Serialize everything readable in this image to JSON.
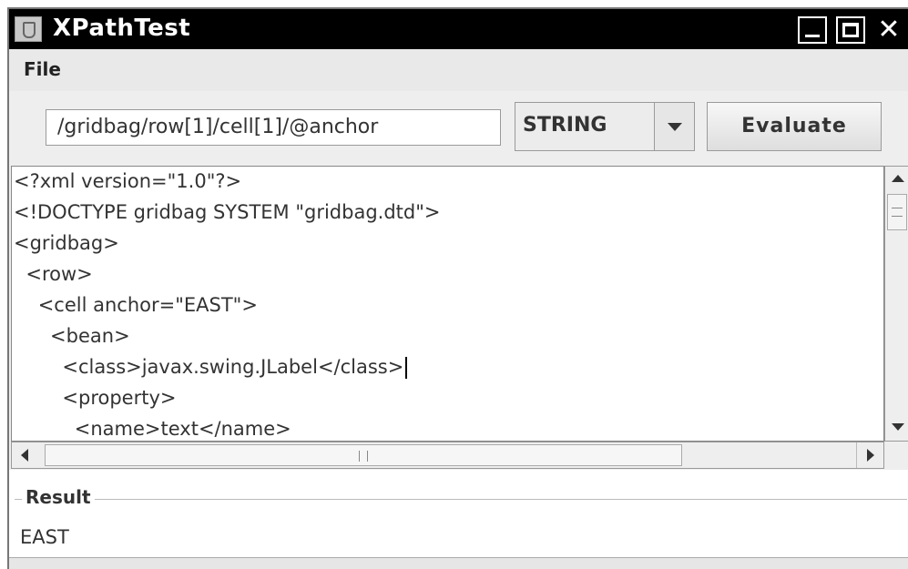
{
  "window": {
    "title": "XPathTest"
  },
  "menu": {
    "file_label": "File"
  },
  "toolbar": {
    "xpath_value": "/gridbag/row[1]/cell[1]/@anchor",
    "type_selected": "STRING",
    "evaluate_label": "Evaluate"
  },
  "editor": {
    "lines": [
      "<?xml version=\"1.0\"?>",
      "<!DOCTYPE gridbag SYSTEM \"gridbag.dtd\">",
      "<gridbag>",
      "  <row>",
      "    <cell anchor=\"EAST\">",
      "      <bean>",
      "        <class>javax.swing.JLabel</class>",
      "        <property>",
      "          <name>text</name>"
    ]
  },
  "result": {
    "title": "Result",
    "value": "EAST"
  },
  "icons": {
    "app": "java-cup-icon",
    "minimize": "minimize-icon",
    "maximize": "maximize-icon",
    "close": "close-icon"
  }
}
